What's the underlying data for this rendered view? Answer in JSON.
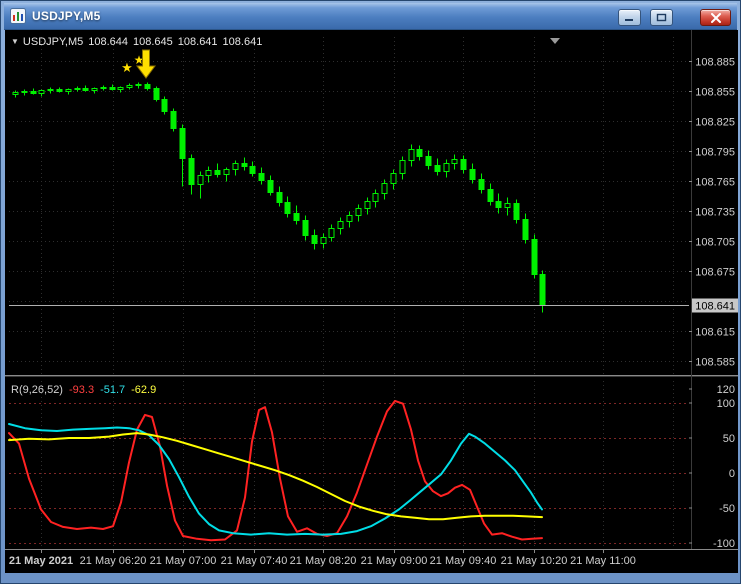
{
  "window": {
    "title": "USDJPY,M5"
  },
  "ohlc_header": {
    "dropdown_arrow": "▼",
    "symbol_period": "USDJPY,M5",
    "open": "108.644",
    "high": "108.645",
    "low": "108.641",
    "close": "108.641"
  },
  "price_axis": {
    "labels": [
      "108.885",
      "108.855",
      "108.825",
      "108.795",
      "108.765",
      "108.735",
      "108.705",
      "108.675",
      "108.615",
      "108.585"
    ],
    "bid_label": "108.641"
  },
  "indicator": {
    "name": "R(9,26,52)",
    "values": [
      {
        "text": "-93.3",
        "color": "#ff4040"
      },
      {
        "text": "-51.7",
        "color": "#30e0e8"
      },
      {
        "text": "-62.9",
        "color": "#ffff40"
      }
    ],
    "axis_labels": [
      "120",
      "100",
      "50",
      "0",
      "-50",
      "-100"
    ]
  },
  "time_axis": {
    "labels": [
      "21 May 2021",
      "21 May 06:20",
      "21 May 07:00",
      "21 May 07:40",
      "21 May 08:20",
      "21 May 09:00",
      "21 May 09:40",
      "21 May 10:20",
      "21 May 11:00"
    ]
  },
  "icons": {
    "star_glyph": "★"
  },
  "colors": {
    "candle": "#00f000",
    "grid": "#2e2e2e",
    "level": "#7e2626",
    "bid_line": "#b0b0b0",
    "axis_text": "#cfcfcf",
    "signal_yellow": "#ffdf00"
  },
  "chart_data": {
    "type": "candlestick+oscillator",
    "symbol": "USDJPY",
    "timeframe": "M5",
    "visible_price_range": [
      108.585,
      108.885
    ],
    "bid_price": 108.641,
    "candles_ohlc": [
      [
        108.852,
        108.856,
        108.849,
        108.854
      ],
      [
        108.854,
        108.857,
        108.851,
        108.855
      ],
      [
        108.855,
        108.858,
        108.852,
        108.853
      ],
      [
        108.853,
        108.857,
        108.85,
        108.856
      ],
      [
        108.856,
        108.859,
        108.853,
        108.857
      ],
      [
        108.857,
        108.859,
        108.854,
        108.855
      ],
      [
        108.855,
        108.858,
        108.852,
        108.857
      ],
      [
        108.857,
        108.86,
        108.855,
        108.858
      ],
      [
        108.858,
        108.861,
        108.855,
        108.856
      ],
      [
        108.856,
        108.859,
        108.853,
        108.858
      ],
      [
        108.858,
        108.861,
        108.856,
        108.859
      ],
      [
        108.859,
        108.862,
        108.856,
        108.857
      ],
      [
        108.857,
        108.86,
        108.854,
        108.859
      ],
      [
        108.859,
        108.863,
        108.857,
        108.861
      ],
      [
        108.861,
        108.864,
        108.858,
        108.862
      ],
      [
        108.862,
        108.864,
        108.856,
        108.858
      ],
      [
        108.858,
        108.86,
        108.845,
        108.847
      ],
      [
        108.847,
        108.85,
        108.832,
        108.835
      ],
      [
        108.835,
        108.838,
        108.815,
        108.818
      ],
      [
        108.818,
        108.822,
        108.76,
        108.788
      ],
      [
        108.788,
        108.792,
        108.752,
        108.762
      ],
      [
        108.762,
        108.775,
        108.748,
        108.771
      ],
      [
        108.771,
        108.78,
        108.764,
        108.776
      ],
      [
        108.776,
        108.783,
        108.769,
        108.772
      ],
      [
        108.772,
        108.779,
        108.765,
        108.777
      ],
      [
        108.777,
        108.786,
        108.771,
        108.783
      ],
      [
        108.783,
        108.789,
        108.776,
        108.78
      ],
      [
        108.78,
        108.785,
        108.77,
        108.773
      ],
      [
        108.773,
        108.779,
        108.762,
        108.766
      ],
      [
        108.766,
        108.771,
        108.751,
        108.754
      ],
      [
        108.754,
        108.76,
        108.74,
        108.744
      ],
      [
        108.744,
        108.75,
        108.729,
        108.733
      ],
      [
        108.733,
        108.741,
        108.722,
        108.726
      ],
      [
        108.726,
        108.731,
        108.706,
        108.711
      ],
      [
        108.711,
        108.717,
        108.697,
        108.703
      ],
      [
        108.703,
        108.713,
        108.698,
        108.709
      ],
      [
        108.709,
        108.722,
        108.705,
        108.718
      ],
      [
        108.718,
        108.729,
        108.712,
        108.725
      ],
      [
        108.725,
        108.735,
        108.719,
        108.731
      ],
      [
        108.731,
        108.742,
        108.725,
        108.738
      ],
      [
        108.738,
        108.749,
        108.732,
        108.745
      ],
      [
        108.745,
        108.757,
        108.739,
        108.753
      ],
      [
        108.753,
        108.767,
        108.747,
        108.763
      ],
      [
        108.763,
        108.777,
        108.757,
        108.773
      ],
      [
        108.773,
        108.79,
        108.767,
        108.786
      ],
      [
        108.786,
        108.802,
        108.78,
        108.797
      ],
      [
        108.797,
        108.801,
        108.786,
        108.79
      ],
      [
        108.79,
        108.796,
        108.777,
        108.781
      ],
      [
        108.781,
        108.788,
        108.771,
        108.775
      ],
      [
        108.775,
        108.787,
        108.769,
        108.783
      ],
      [
        108.783,
        108.792,
        108.777,
        108.787
      ],
      [
        108.787,
        108.791,
        108.773,
        108.777
      ],
      [
        108.777,
        108.783,
        108.763,
        108.767
      ],
      [
        108.767,
        108.773,
        108.753,
        108.757
      ],
      [
        108.757,
        108.763,
        108.741,
        108.745
      ],
      [
        108.745,
        108.753,
        108.733,
        108.739
      ],
      [
        108.739,
        108.749,
        108.731,
        108.743
      ],
      [
        108.743,
        108.747,
        108.723,
        108.727
      ],
      [
        108.727,
        108.733,
        108.703,
        108.707
      ],
      [
        108.707,
        108.712,
        108.668,
        108.672
      ],
      [
        108.672,
        108.676,
        108.634,
        108.641
      ]
    ],
    "indicator": {
      "name": "R(9,26,52)",
      "range": [
        -100,
        100
      ],
      "levels": [
        100,
        50,
        0,
        -50,
        -100
      ],
      "current_values": [
        -93.3,
        -51.7,
        -62.9
      ],
      "series": [
        {
          "name": "fast-line",
          "color": "#ff2222",
          "points": [
            [
              4,
              57
            ],
            [
              14,
              42
            ],
            [
              24,
              -8
            ],
            [
              36,
              -52
            ],
            [
              46,
              -70
            ],
            [
              58,
              -77
            ],
            [
              72,
              -80
            ],
            [
              86,
              -78
            ],
            [
              98,
              -80
            ],
            [
              108,
              -76
            ],
            [
              116,
              -42
            ],
            [
              124,
              15
            ],
            [
              132,
              62
            ],
            [
              140,
              83
            ],
            [
              147,
              80
            ],
            [
              155,
              38
            ],
            [
              162,
              -18
            ],
            [
              170,
              -68
            ],
            [
              178,
              -90
            ],
            [
              192,
              -94
            ],
            [
              206,
              -96
            ],
            [
              220,
              -95
            ],
            [
              232,
              -82
            ],
            [
              240,
              -35
            ],
            [
              247,
              45
            ],
            [
              254,
              90
            ],
            [
              260,
              94
            ],
            [
              267,
              58
            ],
            [
              275,
              -8
            ],
            [
              283,
              -62
            ],
            [
              292,
              -84
            ],
            [
              302,
              -79
            ],
            [
              312,
              -87
            ],
            [
              322,
              -90
            ],
            [
              332,
              -86
            ],
            [
              342,
              -62
            ],
            [
              352,
              -28
            ],
            [
              362,
              12
            ],
            [
              372,
              52
            ],
            [
              382,
              88
            ],
            [
              390,
              103
            ],
            [
              398,
              99
            ],
            [
              406,
              62
            ],
            [
              413,
              18
            ],
            [
              420,
              -12
            ],
            [
              428,
              -26
            ],
            [
              436,
              -33
            ],
            [
              443,
              -29
            ],
            [
              450,
              -21
            ],
            [
              457,
              -17
            ],
            [
              465,
              -24
            ],
            [
              472,
              -48
            ],
            [
              479,
              -72
            ],
            [
              487,
              -88
            ],
            [
              497,
              -86
            ],
            [
              507,
              -91
            ],
            [
              517,
              -95
            ],
            [
              527,
              -94
            ],
            [
              537,
              -93
            ]
          ]
        },
        {
          "name": "medium-line",
          "color": "#00dde6",
          "points": [
            [
              4,
              70
            ],
            [
              20,
              64
            ],
            [
              36,
              61
            ],
            [
              52,
              60
            ],
            [
              68,
              62
            ],
            [
              84,
              63
            ],
            [
              100,
              64
            ],
            [
              112,
              65
            ],
            [
              124,
              64
            ],
            [
              134,
              61
            ],
            [
              144,
              54
            ],
            [
              154,
              40
            ],
            [
              164,
              20
            ],
            [
              174,
              -6
            ],
            [
              184,
              -34
            ],
            [
              194,
              -58
            ],
            [
              204,
              -73
            ],
            [
              214,
              -82
            ],
            [
              228,
              -86
            ],
            [
              246,
              -88
            ],
            [
              264,
              -86
            ],
            [
              282,
              -88
            ],
            [
              300,
              -87
            ],
            [
              318,
              -88
            ],
            [
              336,
              -87
            ],
            [
              352,
              -83
            ],
            [
              366,
              -76
            ],
            [
              380,
              -65
            ],
            [
              394,
              -52
            ],
            [
              406,
              -38
            ],
            [
              416,
              -26
            ],
            [
              426,
              -14
            ],
            [
              436,
              -2
            ],
            [
              446,
              18
            ],
            [
              456,
              42
            ],
            [
              464,
              56
            ],
            [
              470,
              52
            ],
            [
              480,
              42
            ],
            [
              490,
              30
            ],
            [
              500,
              18
            ],
            [
              510,
              4
            ],
            [
              518,
              -12
            ],
            [
              526,
              -28
            ],
            [
              532,
              -42
            ],
            [
              537,
              -52
            ]
          ]
        },
        {
          "name": "slow-line",
          "color": "#ffff00",
          "points": [
            [
              4,
              47
            ],
            [
              24,
              49
            ],
            [
              44,
              48
            ],
            [
              64,
              50
            ],
            [
              84,
              50
            ],
            [
              104,
              52
            ],
            [
              118,
              55
            ],
            [
              132,
              57
            ],
            [
              144,
              55
            ],
            [
              158,
              51
            ],
            [
              172,
              46
            ],
            [
              186,
              40
            ],
            [
              200,
              34
            ],
            [
              214,
              28
            ],
            [
              228,
              22
            ],
            [
              242,
              16
            ],
            [
              256,
              10
            ],
            [
              270,
              4
            ],
            [
              284,
              -3
            ],
            [
              298,
              -11
            ],
            [
              312,
              -20
            ],
            [
              326,
              -30
            ],
            [
              340,
              -40
            ],
            [
              354,
              -48
            ],
            [
              368,
              -54
            ],
            [
              382,
              -59
            ],
            [
              396,
              -62
            ],
            [
              410,
              -64
            ],
            [
              424,
              -66
            ],
            [
              438,
              -66
            ],
            [
              452,
              -64
            ],
            [
              466,
              -62
            ],
            [
              480,
              -61
            ],
            [
              494,
              -61
            ],
            [
              508,
              -61
            ],
            [
              522,
              -62
            ],
            [
              537,
              -63
            ]
          ]
        }
      ]
    }
  }
}
